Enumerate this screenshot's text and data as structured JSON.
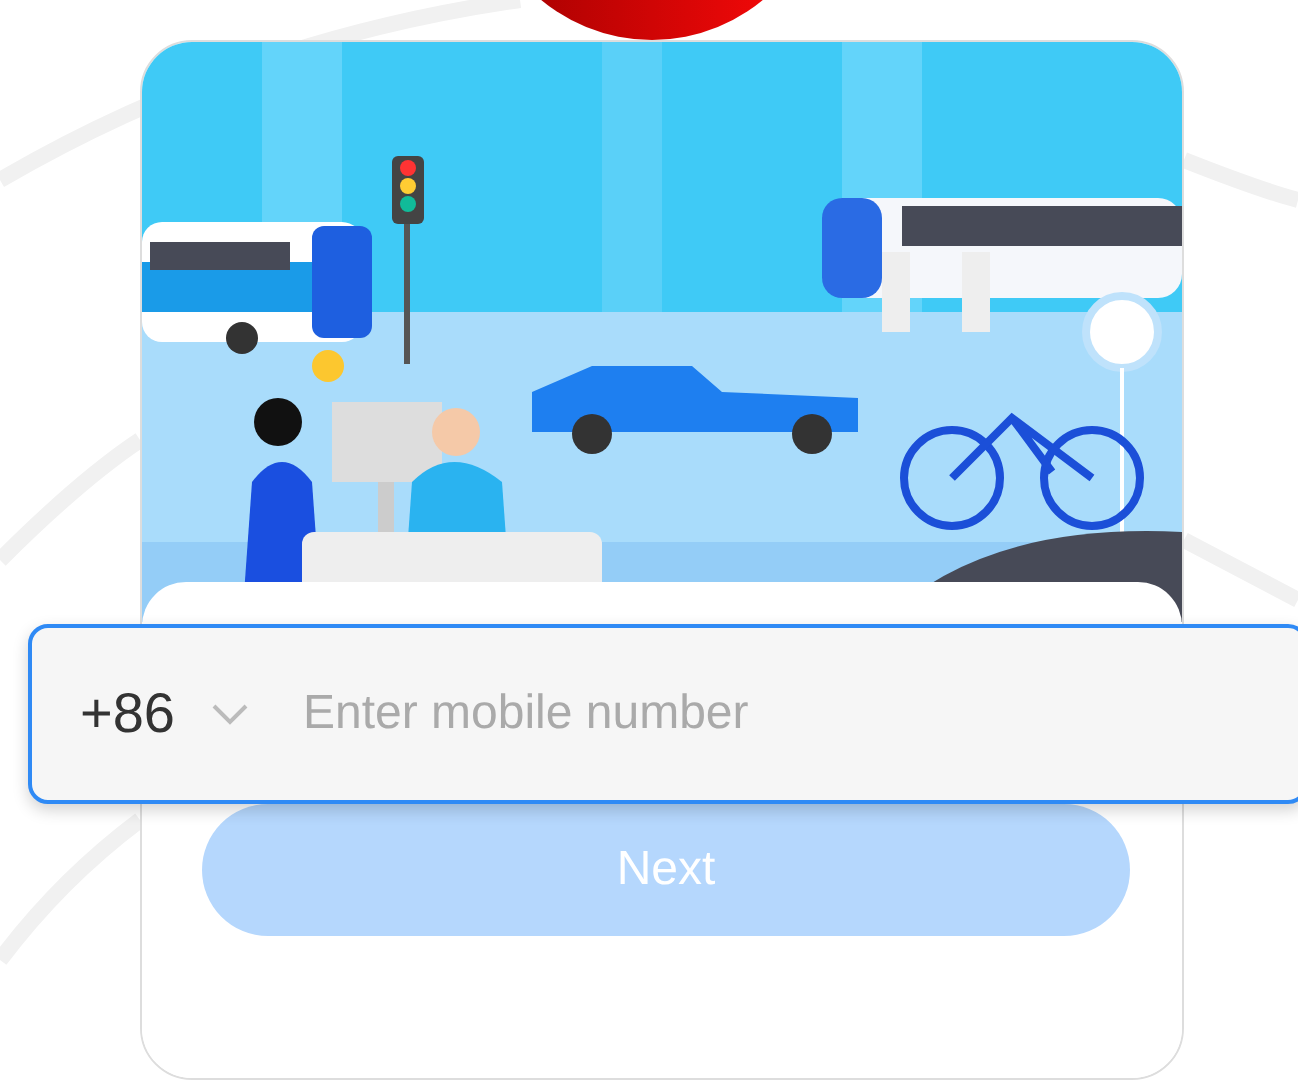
{
  "country_code": {
    "value": "+86"
  },
  "phone": {
    "placeholder": "Enter mobile number",
    "focused": true
  },
  "next_button": {
    "label": "Next",
    "disabled": true
  }
}
